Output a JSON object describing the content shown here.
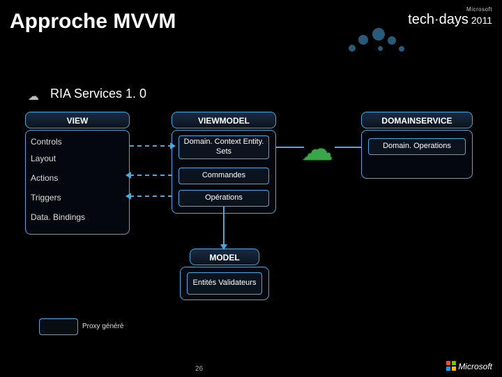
{
  "slide": {
    "title": "Approche MVVM",
    "subtitle": "RIA Services 1. 0",
    "page_number": "26"
  },
  "logo": {
    "brand": "Microsoft",
    "event": "tech·days",
    "year": "2011"
  },
  "view": {
    "header": "VIEW",
    "items": {
      "controls": "Controls",
      "layout": "Layout",
      "actions": "Actions",
      "triggers": "Triggers",
      "databindings": "Data. Bindings"
    }
  },
  "viewmodel": {
    "header": "VIEWMODEL",
    "domain_context": "Domain. Context Entity. Sets",
    "commandes": "Commandes",
    "operations": "Opérations"
  },
  "model": {
    "header": "MODEL",
    "entities": "Entités Validateurs"
  },
  "domainservice": {
    "header": "DOMAINSERVICE",
    "operations": "Domain. Operations"
  },
  "legend": {
    "proxy": "Proxy généré"
  },
  "footer": {
    "brand": "Microsoft"
  }
}
